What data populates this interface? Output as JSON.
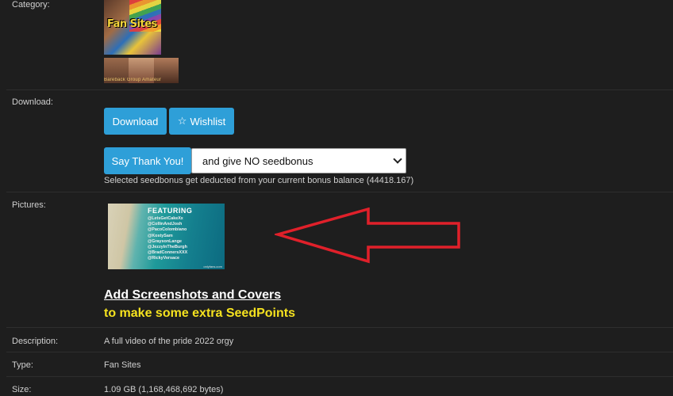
{
  "category": {
    "label": "Category:",
    "main_image_text": "Fan Sites",
    "strip_caption": "Bareback Group Amateur"
  },
  "download": {
    "label": "Download:",
    "download_button": "Download",
    "wishlist_button": "Wishlist",
    "thank_button": "Say Thank You!",
    "seedbonus_select": "and give NO seedbonus",
    "note": "Selected seedbonus get deducted from your current bonus balance (44418.167)"
  },
  "pictures": {
    "label": "Pictures:",
    "image_title": "FEATURING",
    "image_names": [
      "@LetsGetCakeXx",
      "@CollinAndJosh",
      "@PacoColombiano",
      "@KostySam",
      "@GraysonLange",
      "@JezzyInTheBurgh",
      "@BradConnersXXX",
      "@RickyVersace"
    ],
    "image_url": "onlyfans.com",
    "promo_line1": "Add Screenshots and Covers",
    "promo_line2": "to make some extra SeedPoints"
  },
  "description": {
    "label": "Description:",
    "value": "A full video of the pride 2022 orgy"
  },
  "type": {
    "label": "Type:",
    "value": "Fan Sites"
  },
  "size": {
    "label": "Size:",
    "value": "1.09 GB (1,168,468,692 bytes)"
  },
  "colors": {
    "button": "#2e9fd8",
    "promo_yellow": "#f5e21f",
    "arrow": "#e0202a",
    "background": "#1e1e1e"
  }
}
